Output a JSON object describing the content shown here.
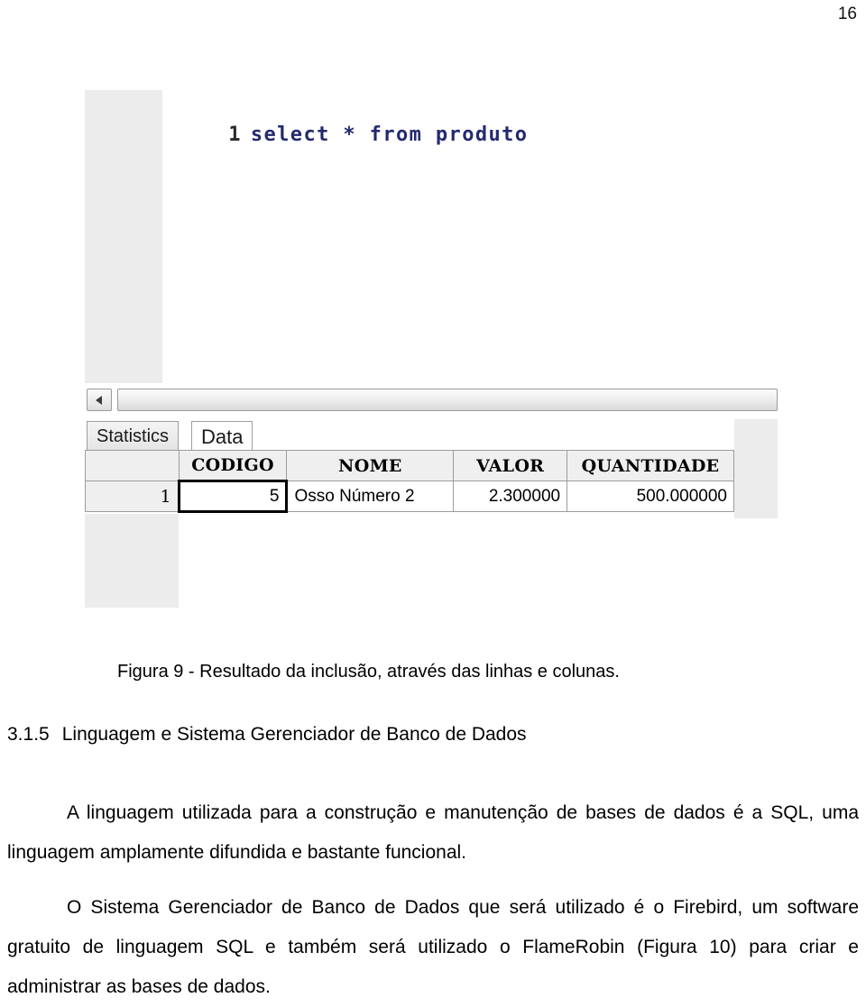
{
  "page": {
    "number": "16"
  },
  "figure": {
    "editor": {
      "line_number": "1",
      "sql": "select * from produto"
    },
    "scrollbar": {
      "left_arrow_icon": "triangle-left-icon"
    },
    "tabs": [
      {
        "label": "Statistics",
        "active": false
      },
      {
        "label": "Data",
        "active": true
      }
    ],
    "grid": {
      "row_header_label": "",
      "columns": [
        "CODIGO",
        "NOME",
        "VALOR",
        "QUANTIDADE"
      ],
      "rows": [
        {
          "index": "1",
          "CODIGO": "5",
          "NOME": "Osso Número 2",
          "VALOR": "2.300000",
          "QUANTIDADE": "500.000000"
        }
      ],
      "selected_cell": "CODIGO"
    },
    "caption": "Figura 9 - Resultado da inclusão, através das linhas e colunas."
  },
  "section": {
    "number": "3.1.5",
    "title": "Linguagem e Sistema Gerenciador de Banco de Dados"
  },
  "body": {
    "paragraph_1_line_1": "A linguagem utilizada para a construção e manutenção de bases de dados é",
    "paragraph_1_line_2": "a SQL, uma linguagem amplamente difundida e bastante funcional.",
    "paragraph_2_line_1": "O Sistema Gerenciador de Banco de Dados que será utilizado é o Firebird,",
    "paragraph_2_line_2": "um software gratuito de linguagem SQL e também será utilizado o FlameRobin",
    "paragraph_2_line_3": "(Figura 10) para criar e administrar as bases de dados."
  },
  "colors": {
    "sql_text": "#232a6e",
    "panel_gray": "#ececec",
    "grid_border": "#9c9c9c"
  }
}
